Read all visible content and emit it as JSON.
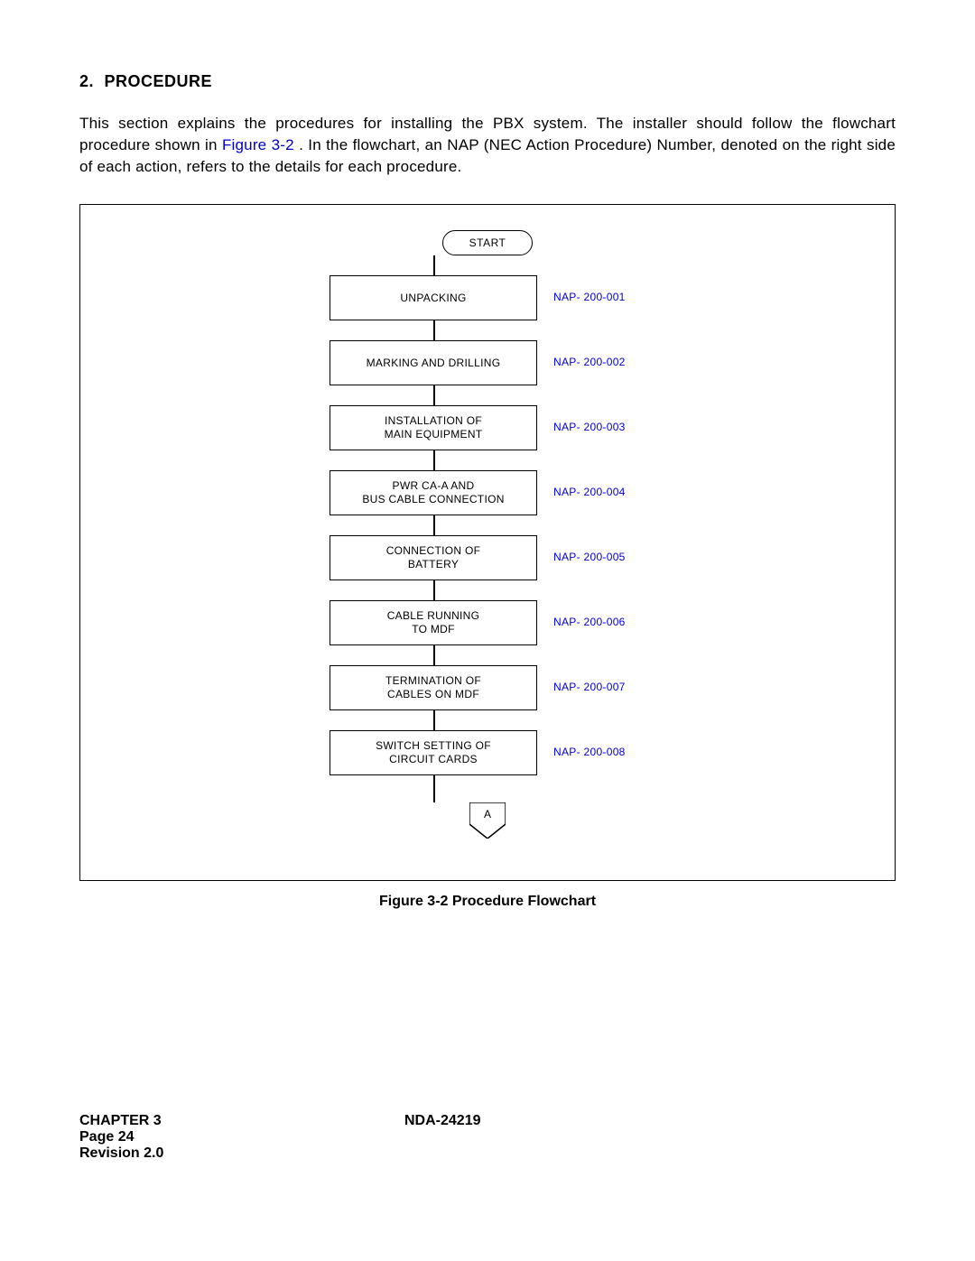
{
  "heading": {
    "num": "2.",
    "title": "PROCEDURE"
  },
  "paragraph": {
    "pre": "This section explains the procedures for installing the PBX system. The installer should follow the flowchart procedure shown in ",
    "figref": "Figure 3-2",
    "post": ". In the flowchart, an NAP (NEC Action Procedure) Number, denoted on the right side of each action, refers to the details for each procedure."
  },
  "flowchart": {
    "start": "START",
    "steps": [
      {
        "lines": [
          "UNPACKING"
        ],
        "nap": "NAP- 200-001"
      },
      {
        "lines": [
          "MARKING AND DRILLING"
        ],
        "nap": "NAP- 200-002"
      },
      {
        "lines": [
          "INSTALLATION OF",
          "MAIN EQUIPMENT"
        ],
        "nap": "NAP- 200-003"
      },
      {
        "lines": [
          "PWR CA-A AND",
          "BUS CABLE CONNECTION"
        ],
        "nap": "NAP- 200-004"
      },
      {
        "lines": [
          "CONNECTION OF",
          "BATTERY"
        ],
        "nap": "NAP- 200-005"
      },
      {
        "lines": [
          "CABLE RUNNING",
          "TO MDF"
        ],
        "nap": "NAP- 200-006"
      },
      {
        "lines": [
          "TERMINATION OF",
          "CABLES ON MDF"
        ],
        "nap": "NAP- 200-007"
      },
      {
        "lines": [
          "SWITCH SETTING OF",
          "CIRCUIT CARDS"
        ],
        "nap": "NAP- 200-008"
      }
    ],
    "end": "A"
  },
  "caption": "Figure 3-2   Procedure Flowchart",
  "footer": {
    "chapter": "CHAPTER 3",
    "docnum": "NDA-24219",
    "page": "Page 24",
    "revision": "Revision 2.0"
  }
}
